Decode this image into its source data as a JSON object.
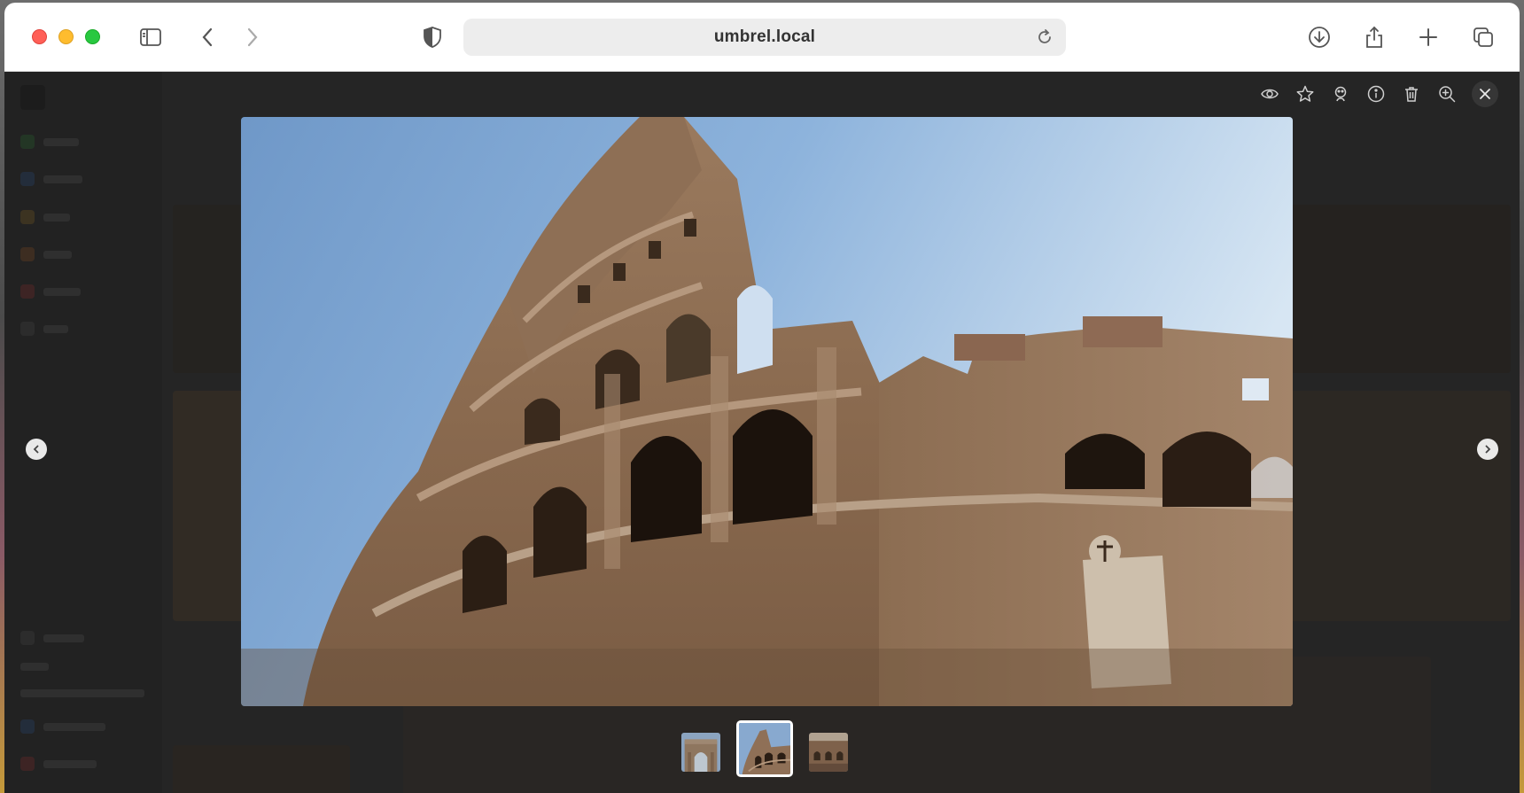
{
  "browser": {
    "url": "umbrel.local",
    "buttons": {
      "sidebar": "sidebar-icon",
      "back": "chevron-left-icon",
      "forward": "chevron-right-icon",
      "privacy": "shield-icon",
      "reload": "reload-icon",
      "download": "download-icon",
      "share": "share-icon",
      "new_tab": "plus-icon",
      "tabs": "tabs-overview-icon"
    }
  },
  "viewer": {
    "actions": [
      "eye-icon",
      "star-icon",
      "face-icon",
      "info-icon",
      "trash-icon",
      "zoom-in-icon",
      "close-icon"
    ],
    "nav": {
      "prev": "chevron-left-icon",
      "next": "chevron-right-icon"
    },
    "thumbnails": [
      {
        "name": "arch-photo",
        "active": false
      },
      {
        "name": "colosseum-photo",
        "active": true
      },
      {
        "name": "colosseum-wall-photo",
        "active": false
      }
    ],
    "colors": {
      "overlay": "#141414",
      "accent": "#ffffff"
    }
  }
}
